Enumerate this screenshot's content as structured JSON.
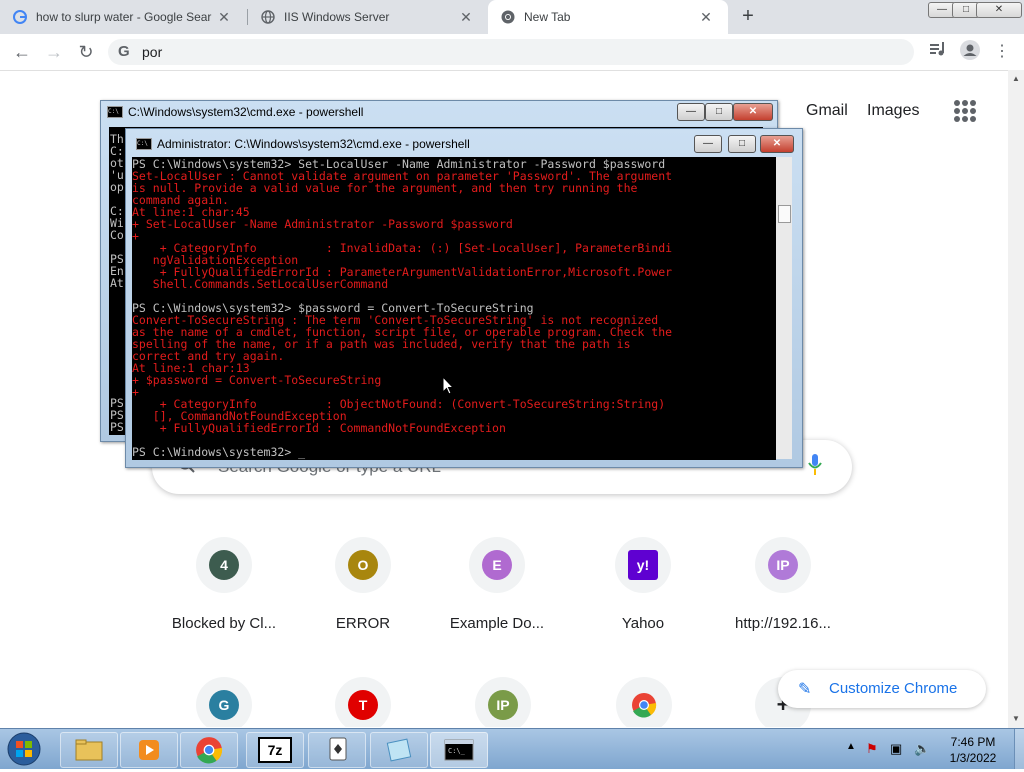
{
  "browser": {
    "tabs": [
      {
        "label": "how to slurp water - Google Sear",
        "icon": "google-icon"
      },
      {
        "label": "IIS Windows Server",
        "icon": "globe-icon"
      },
      {
        "label": "New Tab",
        "icon": "chrome-icon"
      }
    ],
    "window_controls": {
      "minimize": "—",
      "maximize": "□",
      "close": "✕"
    },
    "new_tab": "+",
    "omnibox_text": "por"
  },
  "ntp": {
    "links": {
      "gmail": "Gmail",
      "images": "Images"
    },
    "search_placeholder": "Search Google or type a URL",
    "shortcuts_row1": [
      {
        "label": "Blocked by Cl...",
        "letter": "4",
        "color": "#3d5c4f"
      },
      {
        "label": "ERROR",
        "letter": "O",
        "color": "#a8860e"
      },
      {
        "label": "Example Do...",
        "letter": "E",
        "color": "#b06ad0"
      },
      {
        "label": "Yahoo",
        "letter": "y!",
        "color": "#5f01d1"
      },
      {
        "label": "http://192.16...",
        "letter": "IP",
        "color": "#b07ad8"
      }
    ],
    "shortcuts_row2": [
      {
        "letter": "G",
        "color": "#2a7fa0"
      },
      {
        "letter": "T",
        "color": "#e00000"
      },
      {
        "letter": "IP",
        "color": "#7a9b48"
      },
      {
        "letter": "",
        "color": "#ea4335"
      },
      {
        "letter": "+",
        "color": "#f1f3f4"
      }
    ],
    "customize_label": "Customize Chrome"
  },
  "cmd_back": {
    "title": "C:\\Windows\\system32\\cmd.exe - powershell",
    "visible_left_text": "Th\nC:\not\n'u\nop\n\nC:\nWi\nCo\n\nPS\nEn\nAt\n\n\n\n\n\n\n\n\n\nPS\nPS\nPS"
  },
  "cmd_front": {
    "title": "Administrator: C:\\Windows\\system32\\cmd.exe - powershell",
    "lines": [
      {
        "t": "PS C:\\Windows\\system32> Set-LocalUser -Name Administrator -Password $password",
        "c": "w"
      },
      {
        "t": "Set-LocalUser : Cannot validate argument on parameter 'Password'. The argument",
        "c": "r"
      },
      {
        "t": "is null. Provide a valid value for the argument, and then try running the",
        "c": "r"
      },
      {
        "t": "command again.",
        "c": "r"
      },
      {
        "t": "At line:1 char:45",
        "c": "r"
      },
      {
        "t": "+ Set-LocalUser -Name Administrator -Password $password",
        "c": "r"
      },
      {
        "t": "+",
        "c": "r"
      },
      {
        "t": "    + CategoryInfo          : InvalidData: (:) [Set-LocalUser], ParameterBindi",
        "c": "r"
      },
      {
        "t": "   ngValidationException",
        "c": "r"
      },
      {
        "t": "    + FullyQualifiedErrorId : ParameterArgumentValidationError,Microsoft.Power",
        "c": "r"
      },
      {
        "t": "   Shell.Commands.SetLocalUserCommand",
        "c": "r"
      },
      {
        "t": "",
        "c": "w"
      },
      {
        "t": "PS C:\\Windows\\system32> $password = Convert-ToSecureString",
        "c": "w"
      },
      {
        "t": "Convert-ToSecureString : The term 'Convert-ToSecureString' is not recognized",
        "c": "r"
      },
      {
        "t": "as the name of a cmdlet, function, script file, or operable program. Check the",
        "c": "r"
      },
      {
        "t": "spelling of the name, or if a path was included, verify that the path is",
        "c": "r"
      },
      {
        "t": "correct and try again.",
        "c": "r"
      },
      {
        "t": "At line:1 char:13",
        "c": "r"
      },
      {
        "t": "+ $password = Convert-ToSecureString",
        "c": "r"
      },
      {
        "t": "+",
        "c": "r"
      },
      {
        "t": "    + CategoryInfo          : ObjectNotFound: (Convert-ToSecureString:String)",
        "c": "r"
      },
      {
        "t": "   [], CommandNotFoundException",
        "c": "r"
      },
      {
        "t": "    + FullyQualifiedErrorId : CommandNotFoundException",
        "c": "r"
      },
      {
        "t": "",
        "c": "w"
      },
      {
        "t": "PS C:\\Windows\\system32> _",
        "c": "w"
      }
    ]
  },
  "taskbar": {
    "apps": [
      "explorer",
      "media-player",
      "chrome",
      "7z",
      "solitaire",
      "notepad",
      "cmd"
    ],
    "app_7z_label": "7z",
    "clock_time": "7:46 PM",
    "clock_date": "1/3/2022"
  }
}
